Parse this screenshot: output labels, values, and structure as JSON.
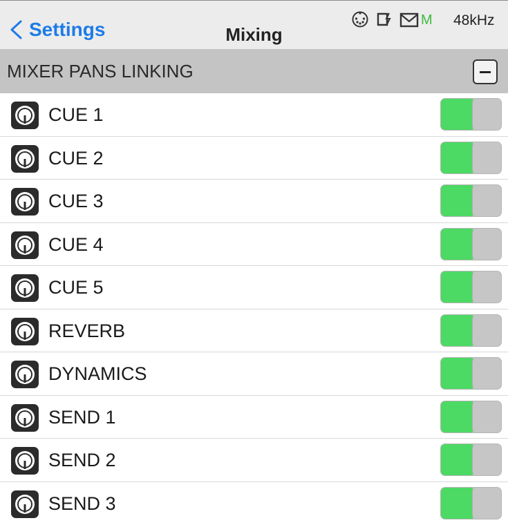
{
  "navbar": {
    "back_label": "Settings",
    "title": "Mixing"
  },
  "status": {
    "icons": [
      "midi-icon",
      "sd-card-icon",
      "mail-icon"
    ],
    "mode": "M",
    "sample_rate": "48kHz"
  },
  "section": {
    "title": "MIXER PANS LINKING",
    "collapse_icon": "minus-icon"
  },
  "colors": {
    "accent": "#1e7be6",
    "toggle_on": "#4cd964",
    "section_bg": "#c4c4c4",
    "status_green": "#3dbb3d"
  },
  "rows": [
    {
      "label": "CUE 1",
      "icon": "pan-knob-icon",
      "enabled": true
    },
    {
      "label": "CUE 2",
      "icon": "pan-knob-icon",
      "enabled": true
    },
    {
      "label": "CUE 3",
      "icon": "pan-knob-icon",
      "enabled": true
    },
    {
      "label": "CUE 4",
      "icon": "pan-knob-icon",
      "enabled": true
    },
    {
      "label": "CUE 5",
      "icon": "pan-knob-icon",
      "enabled": true
    },
    {
      "label": "REVERB",
      "icon": "pan-knob-icon",
      "enabled": true
    },
    {
      "label": "DYNAMICS",
      "icon": "pan-knob-icon",
      "enabled": true
    },
    {
      "label": "SEND 1",
      "icon": "pan-knob-icon",
      "enabled": true
    },
    {
      "label": "SEND 2",
      "icon": "pan-knob-icon",
      "enabled": true
    },
    {
      "label": "SEND 3",
      "icon": "pan-knob-icon",
      "enabled": true
    }
  ]
}
